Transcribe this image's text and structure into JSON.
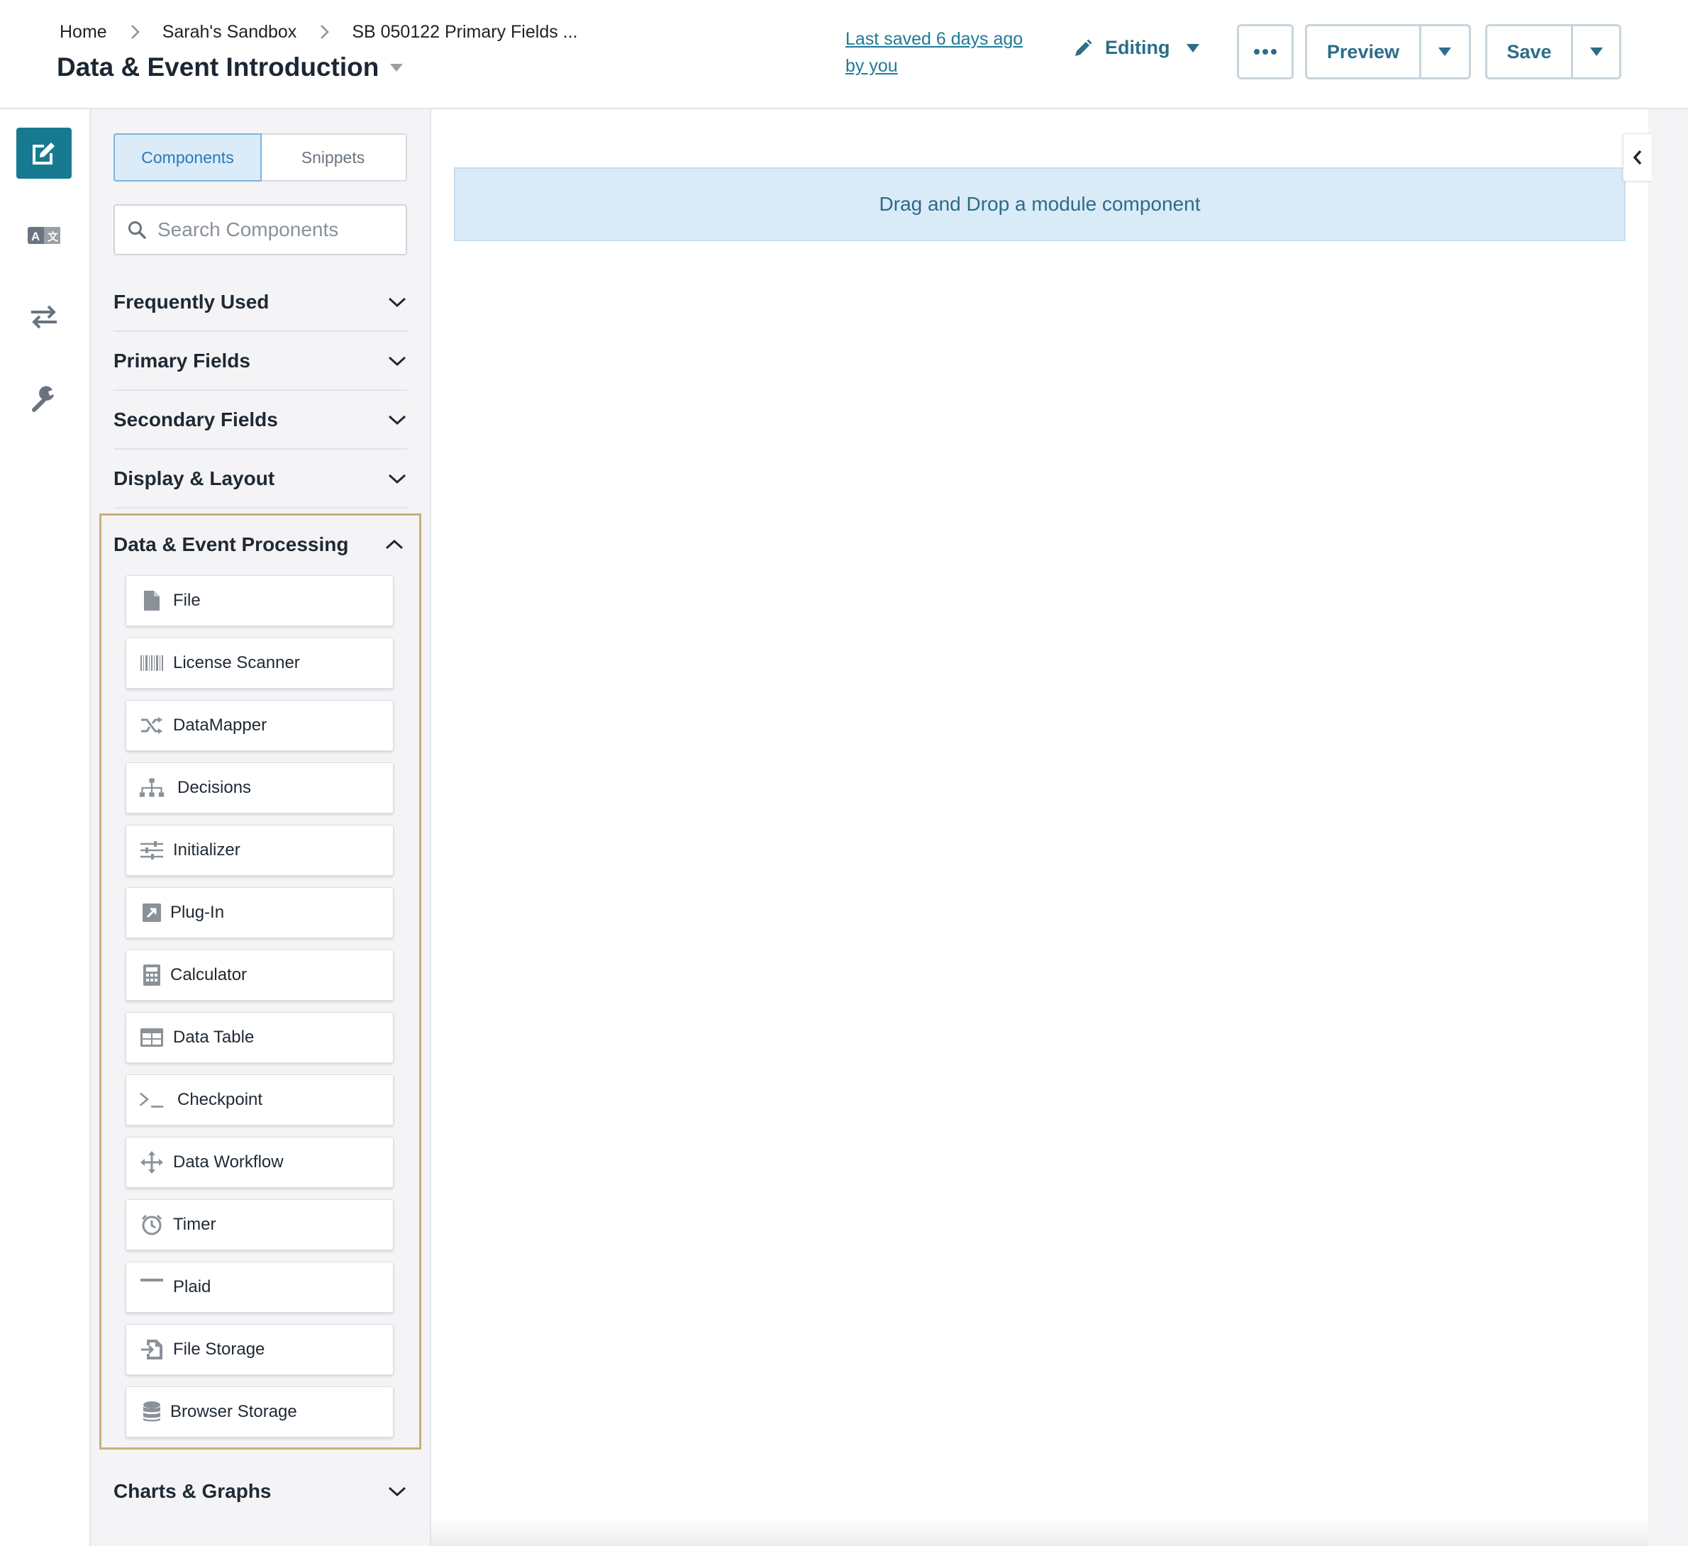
{
  "breadcrumb": [
    "Home",
    "Sarah's Sandbox",
    "SB 050122 Primary Fields ..."
  ],
  "page_title": "Data & Event Introduction",
  "last_saved": "Last saved 6 days ago by you",
  "editing_label": "Editing",
  "preview_label": "Preview",
  "save_label": "Save",
  "more_icon": "more-horizontal-icon",
  "rail": {
    "items": [
      {
        "icon": "edit-icon",
        "active": true
      },
      {
        "icon": "translate-icon",
        "active": false
      },
      {
        "icon": "transfer-icon",
        "active": false
      },
      {
        "icon": "wrench-icon",
        "active": false
      }
    ]
  },
  "panel": {
    "tabs": [
      "Components",
      "Snippets"
    ],
    "active_tab": "Components",
    "search_placeholder": "Search Components",
    "sections": [
      {
        "label": "Frequently Used",
        "expanded": false
      },
      {
        "label": "Primary Fields",
        "expanded": false
      },
      {
        "label": "Secondary Fields",
        "expanded": false
      },
      {
        "label": "Display & Layout",
        "expanded": false
      },
      {
        "label": "Data & Event Processing",
        "expanded": true
      },
      {
        "label": "Charts & Graphs",
        "expanded": false
      }
    ],
    "components": [
      {
        "label": "File",
        "icon": "file-icon"
      },
      {
        "label": "License Scanner",
        "icon": "barcode-icon"
      },
      {
        "label": "DataMapper",
        "icon": "shuffle-icon"
      },
      {
        "label": "Decisions",
        "icon": "sitemap-icon"
      },
      {
        "label": "Initializer",
        "icon": "sliders-icon"
      },
      {
        "label": "Plug-In",
        "icon": "plugin-icon"
      },
      {
        "label": "Calculator",
        "icon": "calculator-icon"
      },
      {
        "label": "Data Table",
        "icon": "table-icon"
      },
      {
        "label": "Checkpoint",
        "icon": "terminal-icon"
      },
      {
        "label": "Data Workflow",
        "icon": "arrows-move-icon"
      },
      {
        "label": "Timer",
        "icon": "alarm-clock-icon"
      },
      {
        "label": "Plaid",
        "icon": "minus-icon"
      },
      {
        "label": "File Storage",
        "icon": "file-import-icon"
      },
      {
        "label": "Browser Storage",
        "icon": "database-icon"
      }
    ]
  },
  "canvas": {
    "dropzone_text": "Drag and Drop a module component"
  },
  "colors": {
    "accent": "#177a91",
    "link": "#1f7a96",
    "dropzone_bg": "#d9ebf7",
    "expanded_border": "#c8b07a"
  }
}
